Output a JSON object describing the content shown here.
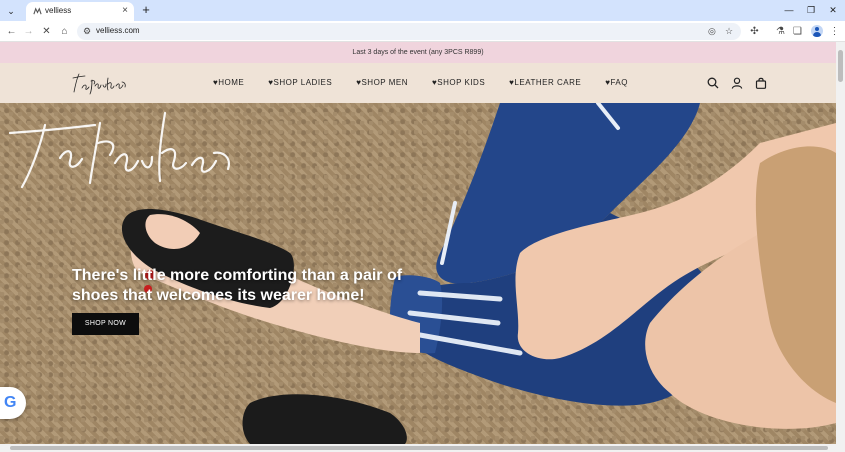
{
  "browser": {
    "tab_title": "velliess",
    "url": "velliess.com",
    "icons": {
      "tab_menu": "chevron-down-icon",
      "new_tab": "plus-icon",
      "back": "back-arrow-icon",
      "forward": "forward-arrow-icon",
      "reload": "close-icon",
      "home": "home-icon",
      "site_info": "tune-icon",
      "eye": "eye-off-icon",
      "star": "star-icon",
      "extensions": "puzzle-icon",
      "labs": "flask-icon",
      "copy": "copy-icon",
      "profile": "avatar-icon",
      "menu": "kebab-menu-icon"
    }
  },
  "announcement": "Last 3 days of the event (any 3PCS R899)",
  "header": {
    "nav": [
      {
        "label": "♥HOME"
      },
      {
        "label": "♥SHOP LADIES"
      },
      {
        "label": "♥SHOP MEN"
      },
      {
        "label": "♥SHOP KIDS"
      },
      {
        "label": "♥LEATHER CARE"
      },
      {
        "label": "♥FAQ"
      }
    ]
  },
  "hero": {
    "heading": "There's little more comforting than a pair of shoes that welcomes its wearer home!",
    "cta_label": "SHOP NOW"
  },
  "colors": {
    "announcement_bg": "#f0d4dd",
    "header_bg": "#efe3d7",
    "button_bg": "#0d0d0d"
  }
}
